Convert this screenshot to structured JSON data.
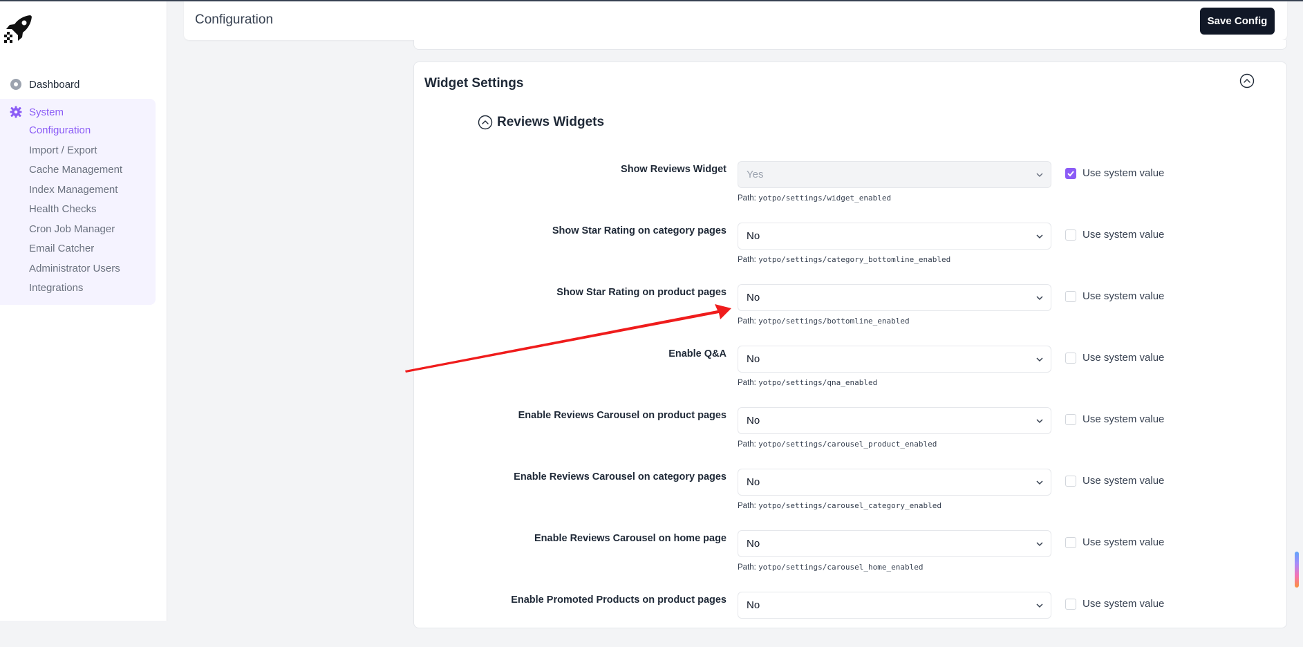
{
  "header": {
    "title": "Configuration",
    "save_label": "Save Config"
  },
  "sidebar": {
    "dashboard": "Dashboard",
    "system": "System",
    "items": [
      {
        "label": "Configuration",
        "active": true
      },
      {
        "label": "Import / Export",
        "active": false
      },
      {
        "label": "Cache Management",
        "active": false
      },
      {
        "label": "Index Management",
        "active": false
      },
      {
        "label": "Health Checks",
        "active": false
      },
      {
        "label": "Cron Job Manager",
        "active": false
      },
      {
        "label": "Email Catcher",
        "active": false
      },
      {
        "label": "Administrator Users",
        "active": false
      },
      {
        "label": "Integrations",
        "active": false
      }
    ]
  },
  "section": {
    "title": "Widget Settings",
    "subsection": "Reviews Widgets",
    "system_value_label": "Use system value",
    "path_prefix": "Path:",
    "rows": [
      {
        "label": "Show Reviews Widget",
        "value": "Yes",
        "disabled": true,
        "use_system": true,
        "path": "yotpo/settings/widget_enabled"
      },
      {
        "label": "Show Star Rating on category pages",
        "value": "No",
        "disabled": false,
        "use_system": false,
        "path": "yotpo/settings/category_bottomline_enabled"
      },
      {
        "label": "Show Star Rating on product pages",
        "value": "No",
        "disabled": false,
        "use_system": false,
        "path": "yotpo/settings/bottomline_enabled"
      },
      {
        "label": "Enable Q&A",
        "value": "No",
        "disabled": false,
        "use_system": false,
        "path": "yotpo/settings/qna_enabled"
      },
      {
        "label": "Enable Reviews Carousel on product pages",
        "value": "No",
        "disabled": false,
        "use_system": false,
        "path": "yotpo/settings/carousel_product_enabled"
      },
      {
        "label": "Enable Reviews Carousel on category pages",
        "value": "No",
        "disabled": false,
        "use_system": false,
        "path": "yotpo/settings/carousel_category_enabled"
      },
      {
        "label": "Enable Reviews Carousel on home page",
        "value": "No",
        "disabled": false,
        "use_system": false,
        "path": "yotpo/settings/carousel_home_enabled"
      },
      {
        "label": "Enable Promoted Products on product pages",
        "value": "No",
        "disabled": false,
        "use_system": false,
        "path": ""
      }
    ]
  },
  "colors": {
    "accent": "#8b5cf6",
    "annotation_arrow": "#ef1c1c",
    "button": "#111827"
  }
}
